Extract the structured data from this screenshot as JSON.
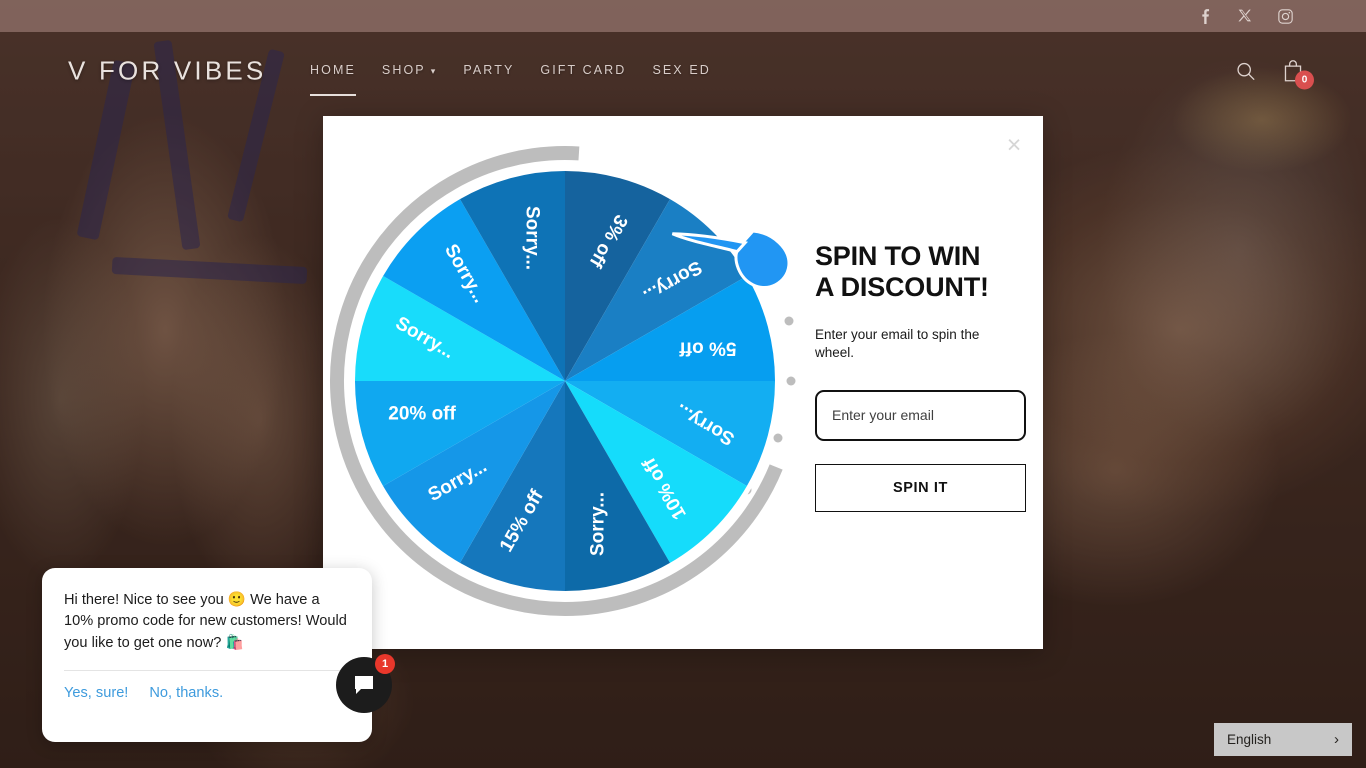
{
  "topbar": {
    "social": [
      {
        "name": "facebook-icon",
        "label": "Facebook"
      },
      {
        "name": "x-twitter-icon",
        "label": "X"
      },
      {
        "name": "instagram-icon",
        "label": "Instagram"
      }
    ]
  },
  "header": {
    "logo": "V FOR VIBES",
    "nav": [
      {
        "label": "HOME",
        "active": true,
        "caret": false
      },
      {
        "label": "SHOP",
        "active": false,
        "caret": true
      },
      {
        "label": "PARTY",
        "active": false,
        "caret": false
      },
      {
        "label": "GIFT CARD",
        "active": false,
        "caret": false
      },
      {
        "label": "SEX ED",
        "active": false,
        "caret": false
      }
    ],
    "caret_glyph": "▾",
    "search_icon": "search-icon",
    "cart_icon": "shopping-bag-icon",
    "cart_count": "0"
  },
  "modal": {
    "close_label": "×",
    "title": "SPIN TO WIN\nA DISCOUNT!",
    "subtitle": "Enter your email to spin the wheel.",
    "email_placeholder": "Enter your email",
    "email_value": "",
    "spin_button": "SPIN IT"
  },
  "wheel": {
    "segments": [
      {
        "label": "3% off",
        "color": "#15639e"
      },
      {
        "label": "Sorry...",
        "color": "#1a7fc4"
      },
      {
        "label": "5% off",
        "color": "#069ef0"
      },
      {
        "label": "Sorry...",
        "color": "#13aef2"
      },
      {
        "label": "10% off",
        "color": "#15dcfb"
      },
      {
        "label": "Sorry...",
        "color": "#0d6aa8"
      },
      {
        "label": "15% off",
        "color": "#1577bc"
      },
      {
        "label": "Sorry...",
        "color": "#1597e8"
      },
      {
        "label": "20% off",
        "color": "#10a8f0"
      },
      {
        "label": "Sorry...",
        "color": "#18dcfb"
      },
      {
        "label": "Sorry...",
        "color": "#0b9ff2"
      },
      {
        "label": "Sorry...",
        "color": "#0e73b6"
      }
    ],
    "pointer_color": "#2196f3",
    "ring_color": "#bdbdbd",
    "text_color": "#ffffff"
  },
  "chat": {
    "message": "Hi there! Nice to see you 🙂 We have a 10% promo code for new customers! Would you like to get one now? 🛍️",
    "actions": [
      "Yes, sure!",
      "No, thanks."
    ],
    "badge": "1",
    "bubble_icon": "chat-bubble-icon"
  },
  "language": {
    "current": "English",
    "chevron": "›"
  }
}
